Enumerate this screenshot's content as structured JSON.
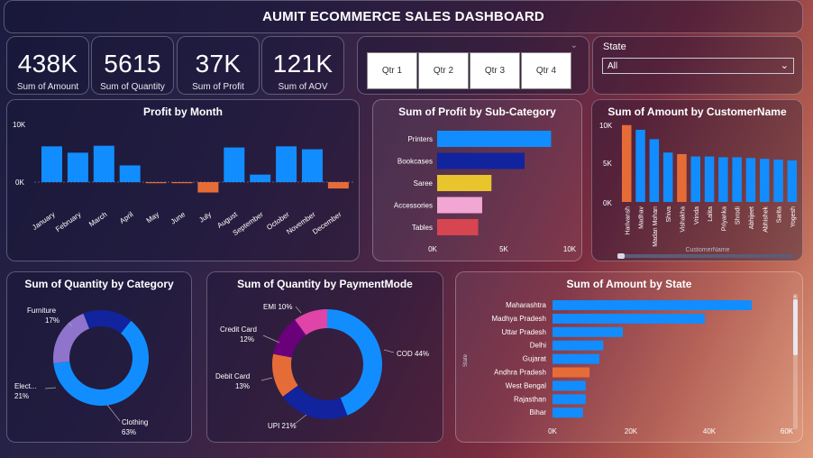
{
  "dashboard_title": "AUMIT ECOMMERCE SALES DASHBOARD",
  "kpis": [
    {
      "value": "438K",
      "label": "Sum of Amount"
    },
    {
      "value": "5615",
      "label": "Sum of Quantity"
    },
    {
      "value": "37K",
      "label": "Sum of Profit"
    },
    {
      "value": "121K",
      "label": "Sum of AOV"
    }
  ],
  "quarter_slicer": {
    "buttons": [
      "Qtr 1",
      "Qtr 2",
      "Qtr 3",
      "Qtr 4"
    ]
  },
  "state_slicer": {
    "label": "State",
    "selected": "All"
  },
  "colors": {
    "blue": "#118dff",
    "navy": "#12239e",
    "orange": "#e66c37",
    "yellow": "#e8c42d",
    "pink": "#f2a6d4",
    "red": "#d64550",
    "purple": "#744ec2",
    "magenta": "#e044a7",
    "dark_purple": "#6b007b",
    "light_purple": "#8e74cc"
  },
  "charts": {
    "profit_by_month": {
      "title": "Profit by Month",
      "yticks": [
        "10K",
        "0K"
      ]
    },
    "profit_by_subcat": {
      "title": "Sum of Profit by Sub-Category",
      "xticks": [
        "0K",
        "5K",
        "10K"
      ]
    },
    "amount_by_customer": {
      "title": "Sum of Amount by CustomerName",
      "yticks": [
        "10K",
        "5K",
        "0K"
      ],
      "xlabel": "CustomerName"
    },
    "qty_by_category": {
      "title": "Sum of Quantity by Category"
    },
    "qty_by_payment": {
      "title": "Sum of Quantity by PaymentMode"
    },
    "amount_by_state": {
      "title": "Sum of Amount by State",
      "ylabel": "State",
      "xticks": [
        "0K",
        "20K",
        "40K",
        "60K"
      ]
    }
  },
  "chart_data": [
    {
      "type": "bar",
      "title": "Profit by Month",
      "categories": [
        "January",
        "February",
        "March",
        "April",
        "May",
        "June",
        "July",
        "August",
        "September",
        "October",
        "November",
        "December"
      ],
      "values": [
        6200,
        5100,
        6300,
        2900,
        -100,
        -100,
        -1800,
        6000,
        1300,
        6200,
        5700,
        -1100
      ],
      "ylim": [
        -3000,
        10000
      ]
    },
    {
      "type": "bar",
      "title": "Sum of Profit by Sub-Category",
      "categories": [
        "Printers",
        "Bookcases",
        "Saree",
        "Accessories",
        "Tables"
      ],
      "values": [
        8600,
        6600,
        4100,
        3400,
        3100
      ],
      "xlim": [
        0,
        10000
      ]
    },
    {
      "type": "bar",
      "title": "Sum of Amount by CustomerName",
      "categories": [
        "Harivansh",
        "Madhav",
        "Madan Mohan",
        "Shiva",
        "Vishakha",
        "Vrinda",
        "Lalita",
        "Priyanka",
        "Shrodi",
        "Abhijeet",
        "Abhishek",
        "Sarita",
        "Yogesh"
      ],
      "values": [
        9800,
        9200,
        8000,
        6300,
        6100,
        5800,
        5800,
        5700,
        5700,
        5600,
        5500,
        5400,
        5300
      ],
      "ylim": [
        0,
        10000
      ]
    },
    {
      "type": "pie",
      "title": "Sum of Quantity by Category",
      "categories": [
        "Clothing",
        "Electronics",
        "Furniture"
      ],
      "labels": [
        "Clothing 63%",
        "Elect... 21%",
        "Furniture 17%"
      ],
      "values": [
        63,
        21,
        17
      ]
    },
    {
      "type": "pie",
      "title": "Sum of Quantity by PaymentMode",
      "categories": [
        "COD",
        "UPI",
        "Debit Card",
        "Credit Card",
        "EMI"
      ],
      "labels": [
        "COD 44%",
        "UPI 21%",
        "Debit Card 13%",
        "Credit Card 12%",
        "EMI 10%"
      ],
      "values": [
        44,
        21,
        13,
        12,
        10
      ]
    },
    {
      "type": "bar",
      "title": "Sum of Amount by State",
      "categories": [
        "Maharashtra",
        "Madhya Pradesh",
        "Uttar Pradesh",
        "Delhi",
        "Gujarat",
        "Andhra Pradesh",
        "West Bengal",
        "Rajasthan",
        "Bihar"
      ],
      "values": [
        51000,
        39000,
        18000,
        13000,
        12000,
        9500,
        8500,
        8500,
        7800
      ],
      "xlim": [
        0,
        60000
      ]
    }
  ]
}
